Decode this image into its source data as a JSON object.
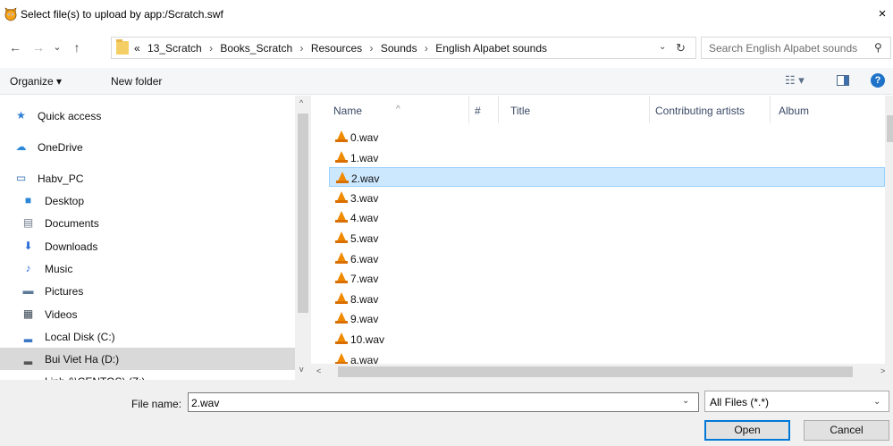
{
  "window": {
    "title": "Select file(s) to upload by app:/Scratch.swf",
    "close_glyph": "×",
    "app_icon": "scratch-cat-icon"
  },
  "nav_buttons": {
    "back": "←",
    "forward": "→",
    "recent": "⌄",
    "up": "↑"
  },
  "address": {
    "overflow": "«",
    "crumbs": [
      "13_Scratch",
      "Books_Scratch",
      "Resources",
      "Sounds",
      "English Alpabet sounds"
    ],
    "separator": "›",
    "dropdown_glyph": "⌄",
    "refresh_glyph": "↻"
  },
  "search": {
    "placeholder": "Search English Alpabet sounds",
    "icon_glyph": "⚲"
  },
  "toolbar": {
    "organize": "Organize ▾",
    "new_folder": "New folder",
    "view_glyph": "☷ ▾",
    "help": "?"
  },
  "navigation": [
    {
      "label": "Quick access",
      "icon": "★",
      "color": "#2f7fd8",
      "icon_name": "star-icon"
    },
    {
      "label": "OneDrive",
      "icon": "☁",
      "color": "#2b88d8",
      "icon_name": "cloud-icon"
    },
    {
      "label": "Habv_PC",
      "icon": "▭",
      "color": "#2b6cb0",
      "icon_name": "computer-icon"
    },
    {
      "label": "Desktop",
      "icon": "■",
      "color": "#2b88d8",
      "icon_name": "desktop-icon"
    },
    {
      "label": "Documents",
      "icon": "▤",
      "color": "#6f7b8a",
      "icon_name": "documents-icon"
    },
    {
      "label": "Downloads",
      "icon": "⬇",
      "color": "#2b6cd8",
      "icon_name": "downloads-icon"
    },
    {
      "label": "Music",
      "icon": "♪",
      "color": "#2b6cd8",
      "icon_name": "music-icon"
    },
    {
      "label": "Pictures",
      "icon": "▬",
      "color": "#5b7a9a",
      "icon_name": "pictures-icon"
    },
    {
      "label": "Videos",
      "icon": "▦",
      "color": "#33414f",
      "icon_name": "videos-icon"
    },
    {
      "label": "Local Disk (C:)",
      "icon": "▂",
      "color": "#3a77c4",
      "icon_name": "local-disk-icon"
    },
    {
      "label": "Bui Viet Ha (D:)",
      "icon": "▂",
      "color": "#555555",
      "icon_name": "drive-icon",
      "selected": true
    },
    {
      "label": "Linh (\\\\CENTOS) (Z:)",
      "icon": "▂",
      "color": "#777777",
      "icon_name": "network-drive-icon"
    }
  ],
  "columns": {
    "name": "Name",
    "number": "#",
    "title": "Title",
    "artists": "Contributing artists",
    "album": "Album"
  },
  "files": [
    {
      "name": "0.wav"
    },
    {
      "name": "1.wav"
    },
    {
      "name": "2.wav",
      "selected": true
    },
    {
      "name": "3.wav"
    },
    {
      "name": "4.wav"
    },
    {
      "name": "5.wav"
    },
    {
      "name": "6.wav"
    },
    {
      "name": "7.wav"
    },
    {
      "name": "8.wav"
    },
    {
      "name": "9.wav"
    },
    {
      "name": "10.wav"
    },
    {
      "name": "a.wav"
    }
  ],
  "scroll_arrows": {
    "up": "^",
    "down": "v",
    "left": "<",
    "right": ">"
  },
  "bottom": {
    "file_name_label": "File name:",
    "file_name_value": "2.wav",
    "file_name_dropdown": "⌄",
    "file_type": "All Files (*.*)",
    "file_type_caret": "⌄",
    "open_label": "Open",
    "cancel_label": "Cancel"
  },
  "colors": {
    "selection_bg": "#cce8ff",
    "nav_selected_bg": "#d9d9d9",
    "accent": "#0078d7"
  }
}
